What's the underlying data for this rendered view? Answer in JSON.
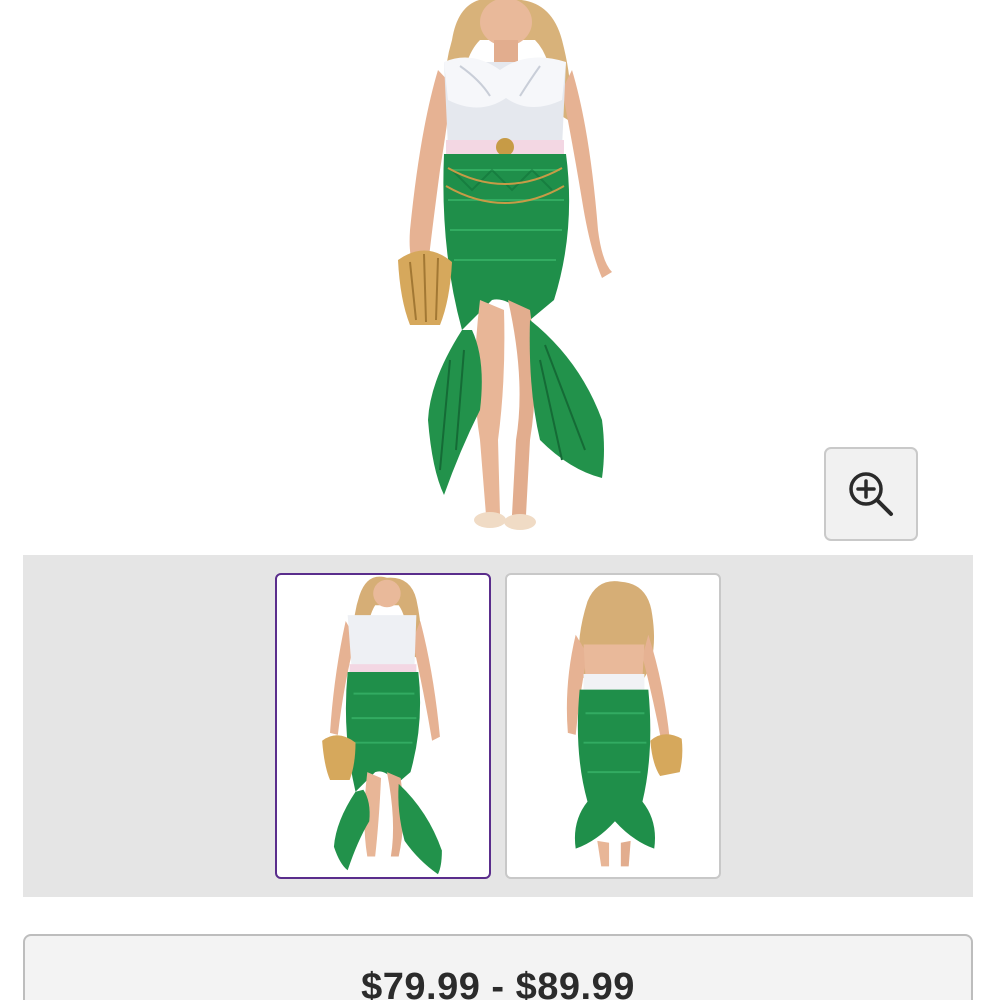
{
  "product": {
    "main_image_alt": "",
    "zoom_icon": "zoom-in-icon",
    "thumbnails": [
      {
        "view": "front",
        "selected": true
      },
      {
        "view": "back",
        "selected": false
      }
    ],
    "price_range": "$79.99 - $89.99"
  },
  "colors": {
    "skirt_green": "#1f8f4a",
    "selected_thumb_border": "#5a2d8c",
    "strip_background": "#e5e5e5"
  }
}
